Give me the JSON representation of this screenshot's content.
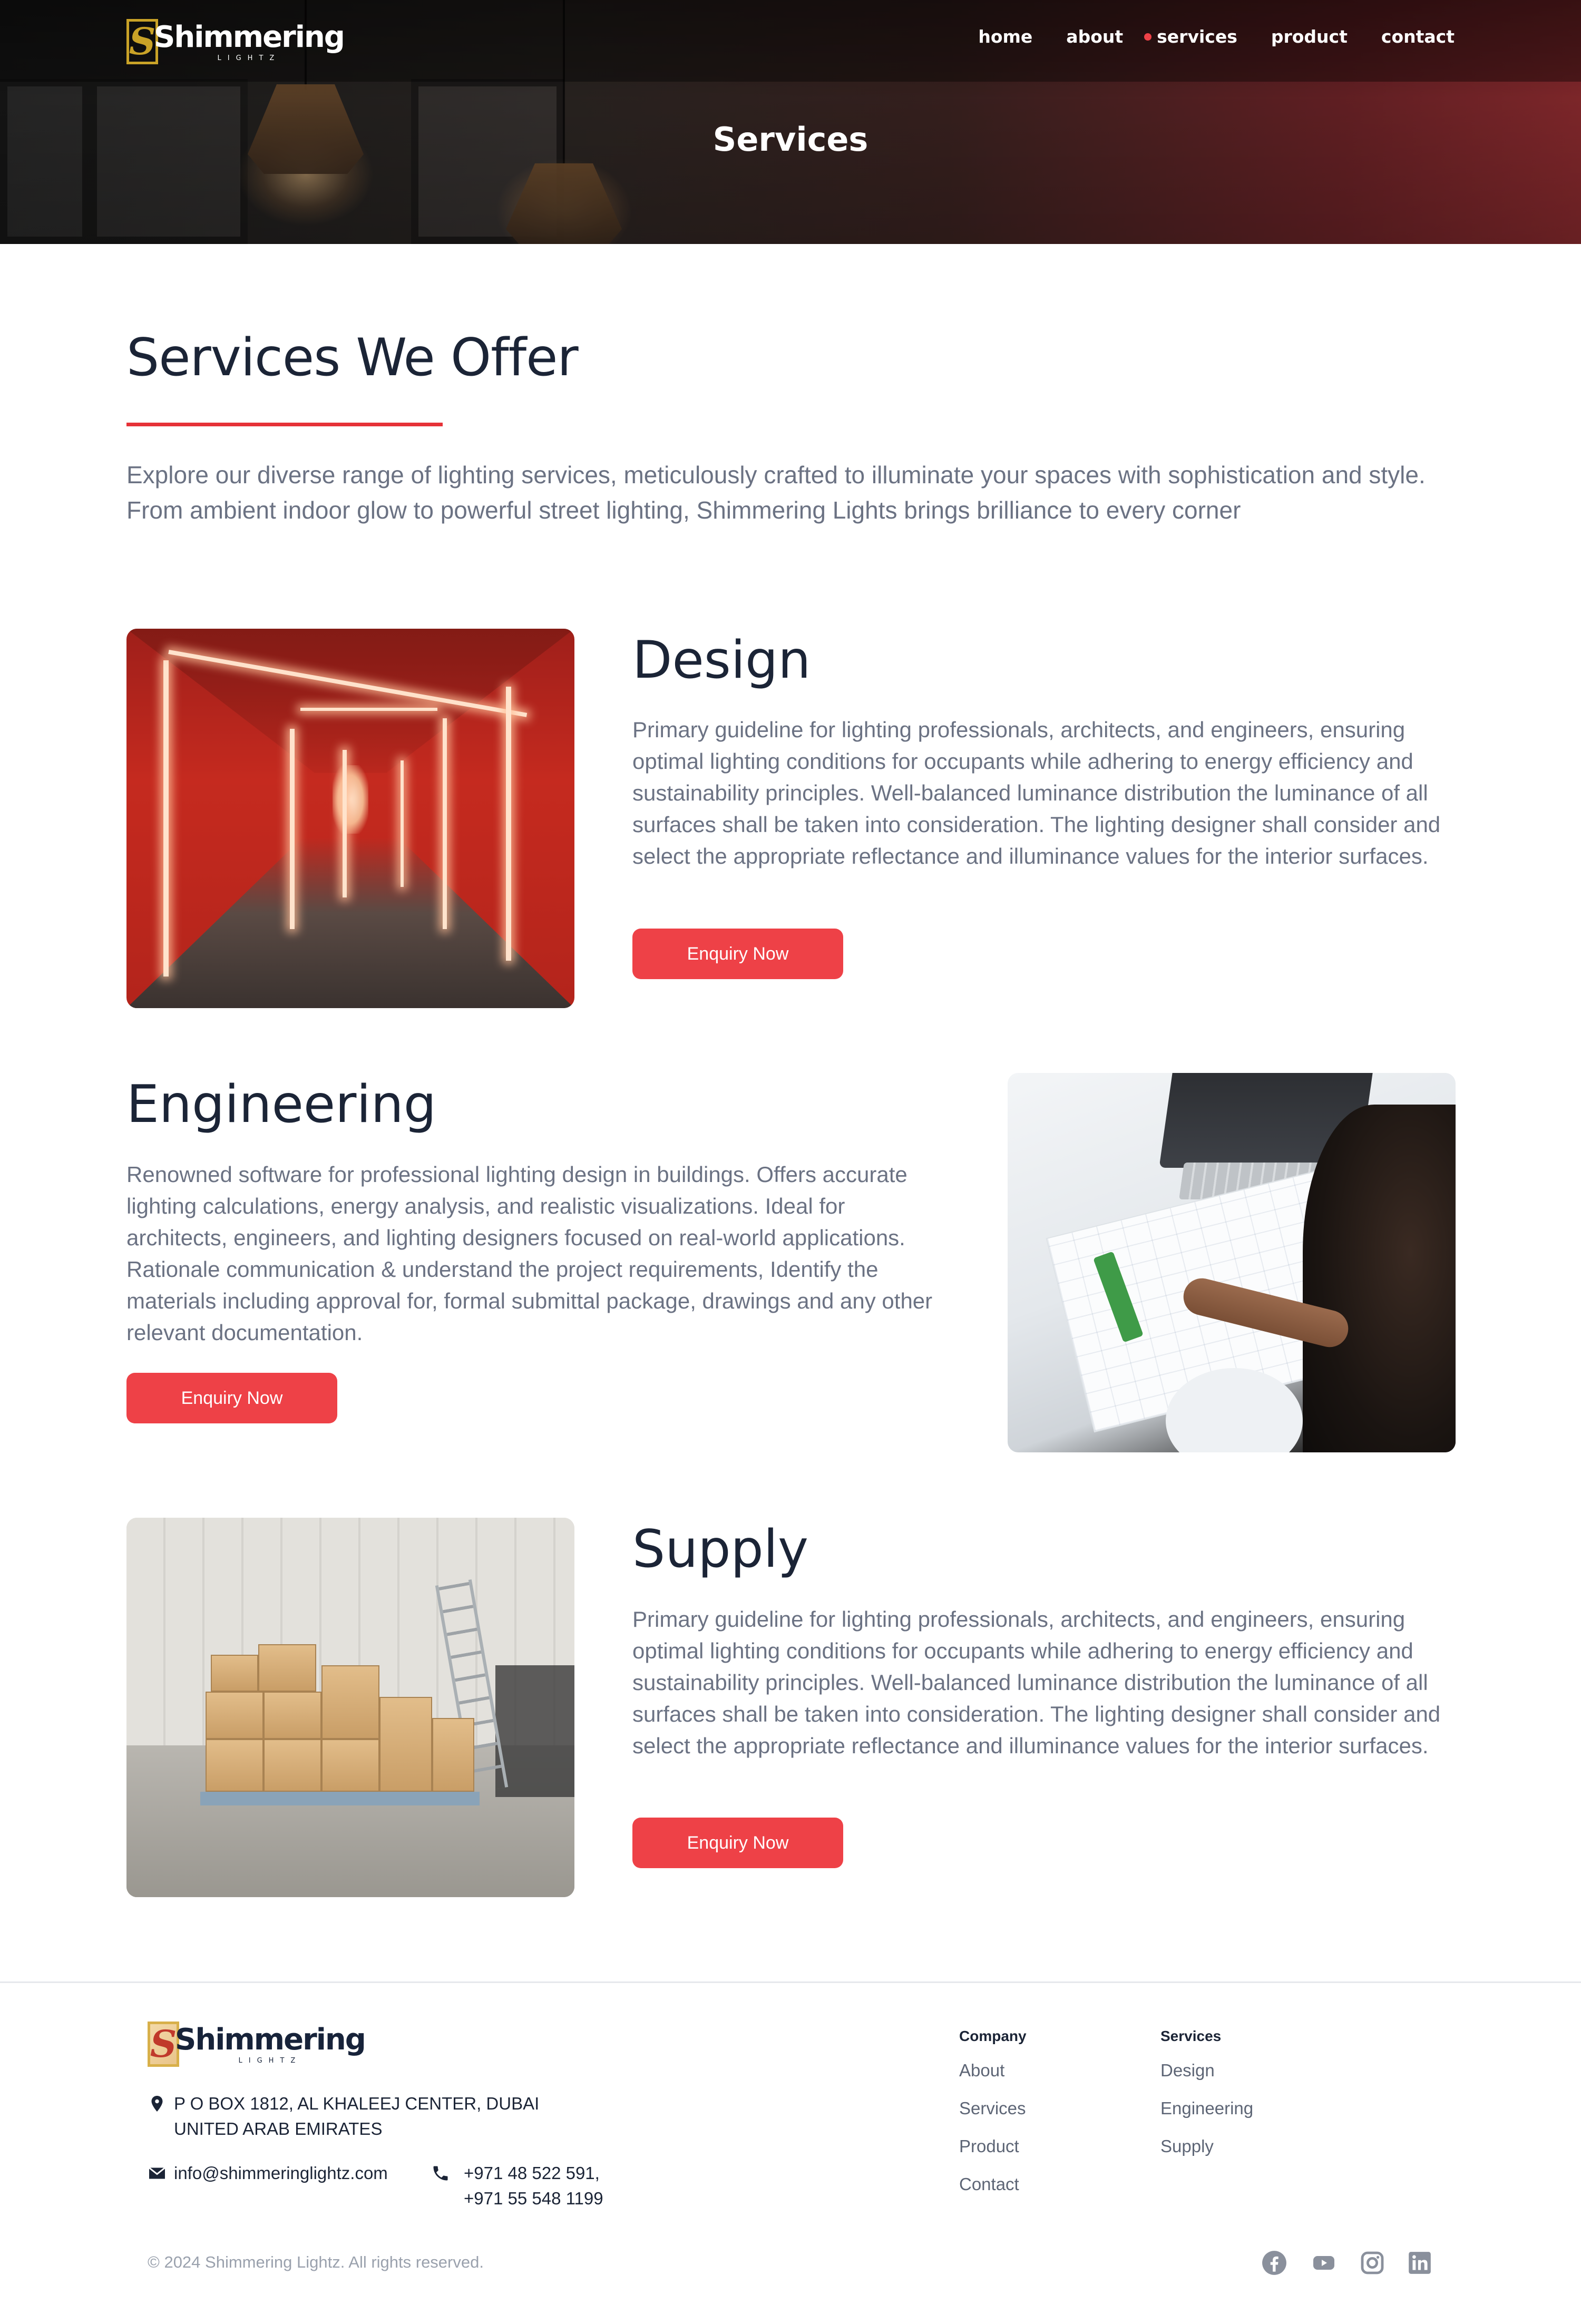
{
  "brand": {
    "name": "Shimmering",
    "sub": "LIGHTZ",
    "mark": "S",
    "accent": "#ee4147",
    "gold": "#c9a227"
  },
  "nav": {
    "items": [
      {
        "label": "home"
      },
      {
        "label": "about"
      },
      {
        "label": "services",
        "active": true
      },
      {
        "label": "product"
      },
      {
        "label": "contact"
      }
    ]
  },
  "hero": {
    "title": "Services"
  },
  "main": {
    "title": "Services We Offer",
    "intro": "Explore our diverse range of lighting services, meticulously crafted to illuminate your spaces with sophistication and style. From ambient indoor glow to powerful street lighting, Shimmering Lights brings brilliance to every corner"
  },
  "services": [
    {
      "title": "Design",
      "description": "Primary guideline for lighting professionals, architects, and engineers, ensuring optimal lighting conditions for occupants while adhering to energy efficiency and sustainability principles. Well-balanced luminance distribution the luminance of all surfaces shall be taken into consideration. The lighting designer shall consider and select the appropriate reflectance and illuminance values for the interior surfaces.",
      "button": "Enquiry Now",
      "image": "red-lit-corridor"
    },
    {
      "title": "Engineering",
      "description": "Renowned software for professional lighting design in buildings. Offers accurate lighting calculations, energy analysis, and realistic visualizations. Ideal for architects, engineers, and lighting designers focused on real-world applications. Rationale communication & understand the project requirements, Identify the materials including approval for, formal submittal package, drawings and any other relevant documentation.",
      "button": "Enquiry Now",
      "image": "engineer-drawing-plans"
    },
    {
      "title": "Supply",
      "description": "Primary guideline for lighting professionals, architects, and engineers, ensuring optimal lighting conditions for occupants while adhering to energy efficiency and sustainability principles. Well-balanced luminance distribution the luminance of all surfaces shall be taken into consideration. The lighting designer shall consider and select the appropriate reflectance and illuminance values for the interior surfaces.",
      "button": "Enquiry Now",
      "image": "warehouse-boxes"
    }
  ],
  "footer": {
    "address_line1": "P O BOX 1812, AL KHALEEJ CENTER, DUBAI",
    "address_line2": "UNITED ARAB EMIRATES",
    "email": "info@shimmeringlightz.com",
    "phone1": "+971 48 522 591,",
    "phone2": "+971 55 548 1199",
    "company": {
      "heading": "Company",
      "links": [
        "About",
        "Services",
        "Product",
        "Contact"
      ]
    },
    "services": {
      "heading": "Services",
      "links": [
        "Design",
        "Engineering",
        "Supply"
      ]
    },
    "copyright": "© 2024 Shimmering Lightz. All rights reserved.",
    "social": [
      "facebook-icon",
      "youtube-icon",
      "instagram-icon",
      "linkedin-icon"
    ],
    "icon_color": "#8a909c"
  }
}
